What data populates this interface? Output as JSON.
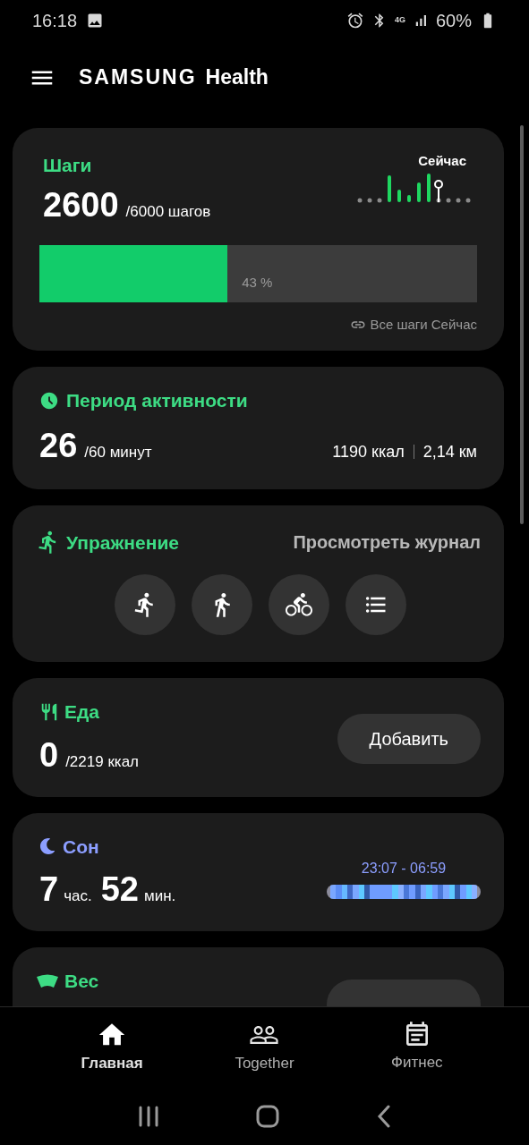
{
  "status_bar": {
    "time": "16:18",
    "network": "4G",
    "battery": "60%"
  },
  "header": {
    "brand": "SAMSUNG",
    "app": "Health"
  },
  "steps": {
    "title": "Шаги",
    "value": "2600",
    "goal": "/6000 шагов",
    "now_label": "Сейчас",
    "level": 0.43,
    "percent": "43 %",
    "link": "Все шаги Сейчас"
  },
  "activity": {
    "title": "Период активности",
    "value": "26",
    "goal": "/60 минут",
    "calories": "1190 ккал",
    "distance": "2,14 км"
  },
  "exercise": {
    "title": "Упражнение",
    "link": "Просмотреть журнал",
    "shortcuts": [
      {
        "kind": "run"
      },
      {
        "kind": "walk"
      },
      {
        "kind": "bike"
      },
      {
        "kind": "list"
      }
    ]
  },
  "food": {
    "title": "Еда",
    "value": "0",
    "goal": "/2219 ккал",
    "button": "Добавить"
  },
  "sleep": {
    "title": "Сон",
    "hours": "7",
    "hours_unit": "час.",
    "minutes": "52",
    "minutes_unit": "мин.",
    "range": "23:07 - 06:59"
  },
  "weight": {
    "title": "Вес"
  },
  "bottom_nav": [
    {
      "kind": "home",
      "label": "Главная",
      "selected": true
    },
    {
      "kind": "together",
      "label": "Together",
      "selected": false
    },
    {
      "kind": "fitness",
      "label": "Фитнес",
      "selected": false
    }
  ]
}
